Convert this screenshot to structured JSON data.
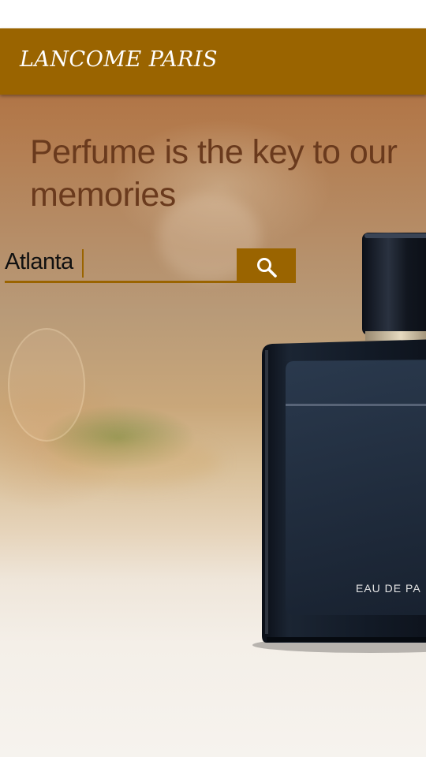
{
  "app_bar": {
    "title": "LANCOME PARIS"
  },
  "hero": {
    "headline": "Perfume is the key to our memories",
    "bottle_label": "EAU DE PA"
  },
  "search": {
    "value": "Atlanta",
    "icon": "search-icon"
  },
  "colors": {
    "brand": "#9a6400",
    "headline": "#6a3a1d"
  }
}
